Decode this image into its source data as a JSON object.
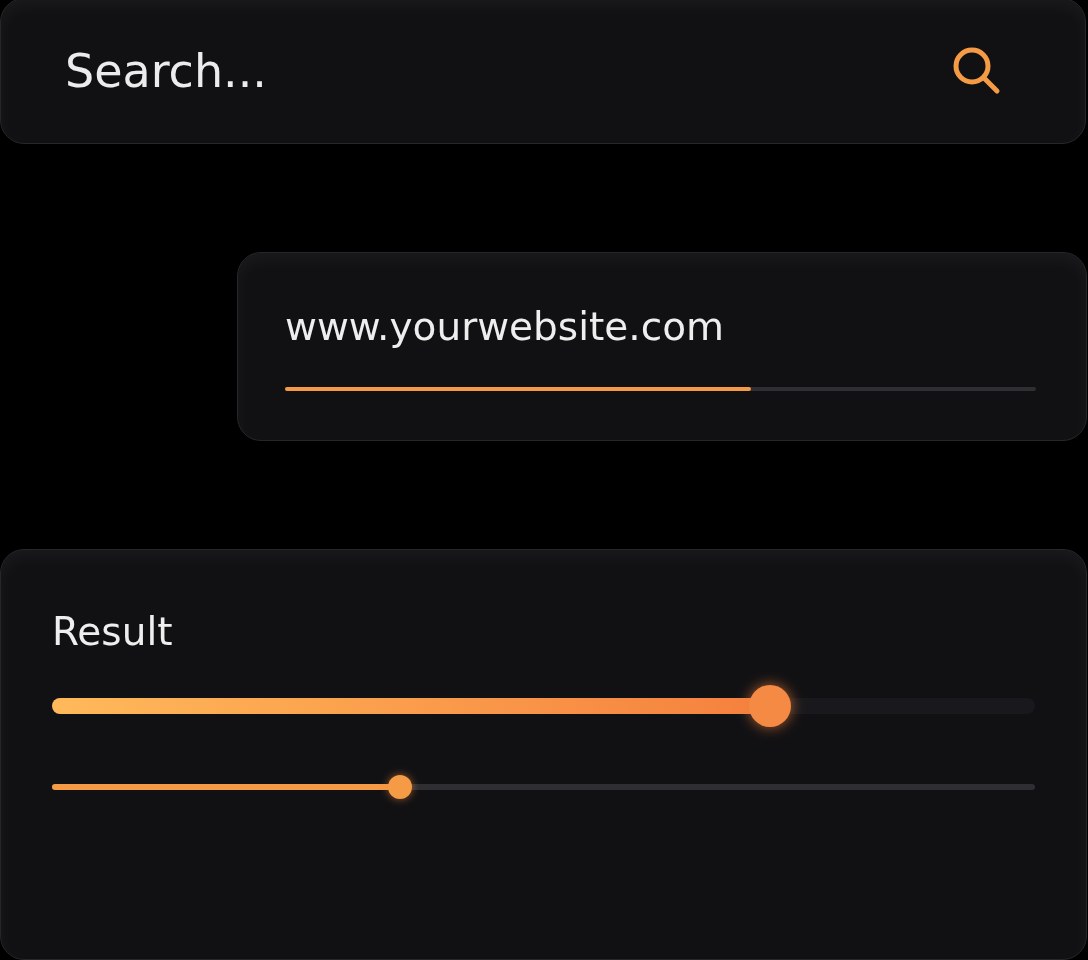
{
  "search": {
    "placeholder": "Search..."
  },
  "url_field": {
    "value": "www.yourwebsite.com",
    "level": 0.62
  },
  "result": {
    "title": "Result",
    "sliders": [
      {
        "kind": "thick",
        "level": 0.73
      },
      {
        "kind": "thin",
        "level": 0.354
      }
    ]
  }
}
